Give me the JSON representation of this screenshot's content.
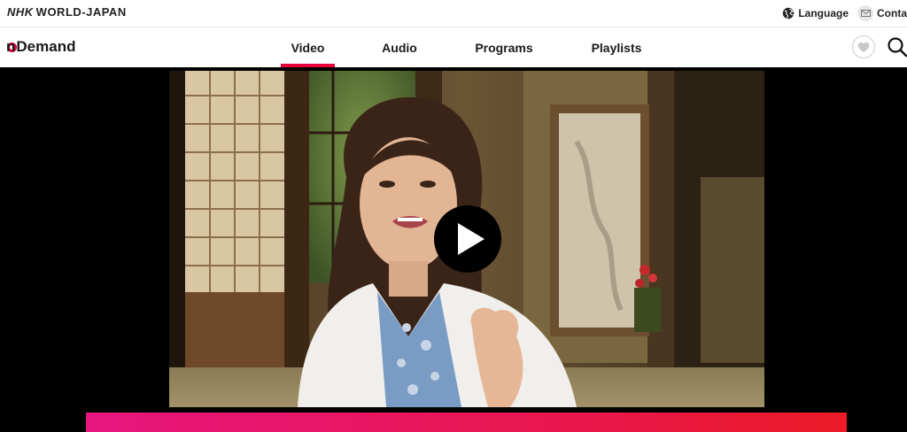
{
  "site": {
    "brand_nhk": "NHK",
    "brand_world": "WORLD-JAPAN",
    "language_label": "Language",
    "contact_label": "Conta"
  },
  "nav": {
    "logo_on": "On",
    "logo_demand": "Demand",
    "tabs": [
      {
        "label": "Video",
        "active": true
      },
      {
        "label": "Audio",
        "active": false
      },
      {
        "label": "Programs",
        "active": false
      },
      {
        "label": "Playlists",
        "active": false
      }
    ],
    "favorite_icon": "heart-icon",
    "search_icon": "search-icon"
  },
  "player": {
    "play_icon": "play-icon",
    "thumbnail": "woman-speaking-in-traditional-japanese-room"
  },
  "colors": {
    "accent": "#e8003d",
    "band_start": "#e6167f",
    "band_end": "#ec1b26"
  }
}
